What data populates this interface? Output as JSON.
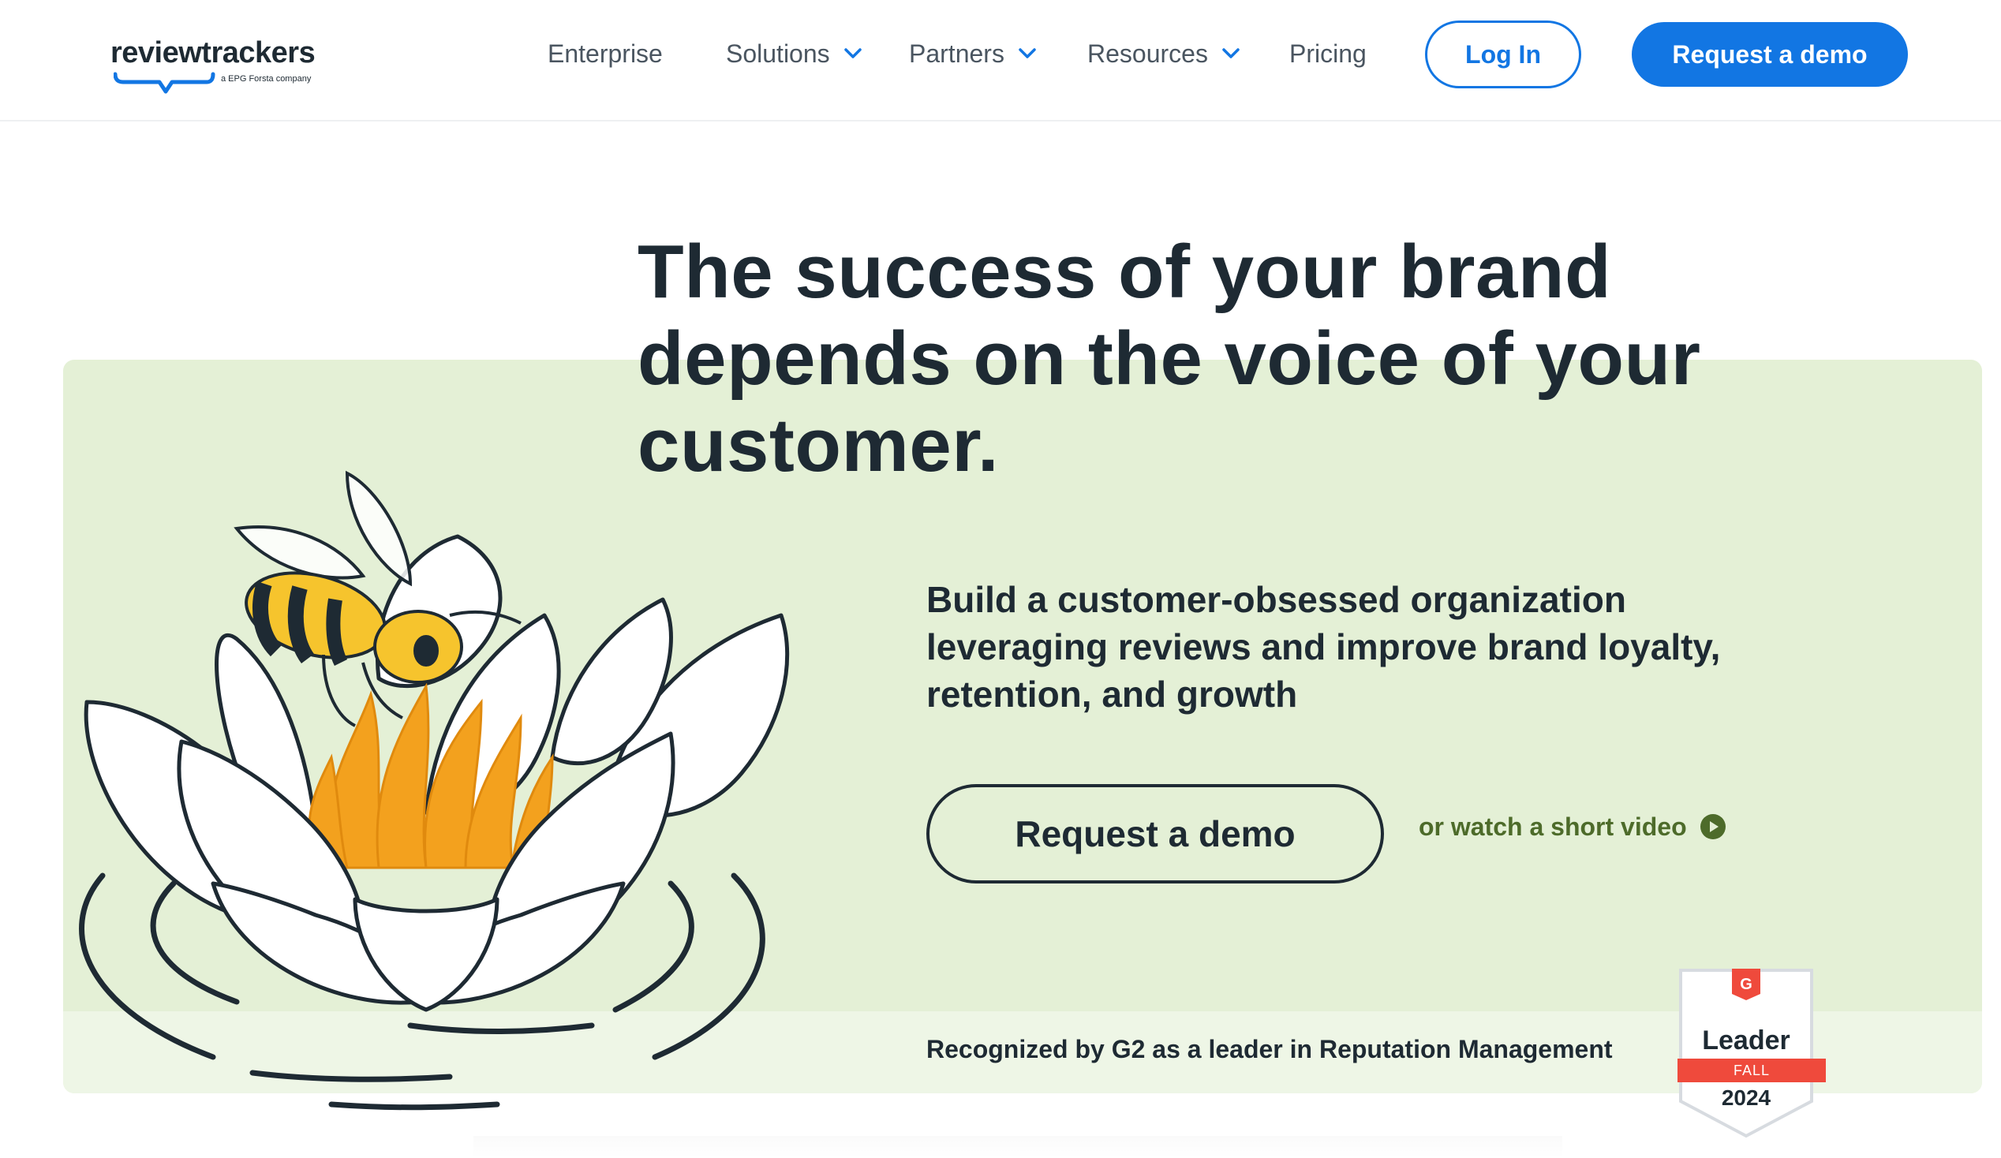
{
  "nav": {
    "logo_text": "reviewtrackers",
    "logo_sub": "a EPG Forsta company",
    "items": [
      {
        "label": "Enterprise",
        "dropdown": false
      },
      {
        "label": "Solutions",
        "dropdown": true
      },
      {
        "label": "Partners",
        "dropdown": true
      },
      {
        "label": "Resources",
        "dropdown": true
      },
      {
        "label": "Pricing",
        "dropdown": false
      }
    ],
    "login_label": "Log In",
    "demo_label": "Request a demo"
  },
  "hero": {
    "headline_lines": [
      "The success of your brand",
      "depends on the voice of your",
      "customer."
    ],
    "sub_lines": [
      "Build a customer-obsessed organization",
      "leveraging reviews and improve brand loyalty,",
      "retention, and growth"
    ],
    "cta_label": "Request a demo",
    "video_link": "or watch a short video",
    "recognized": "Recognized by G2 as a leader in Reputation Management"
  },
  "badge": {
    "title": "Leader",
    "season": "FALL",
    "year": "2024"
  },
  "colors": {
    "primary": "#1276e3",
    "hero_bg": "#e4f0d6",
    "text": "#1e2a33",
    "link_green": "#4d6b2a",
    "badge_red": "#ef4a3c",
    "bee_yellow": "#f6c42d",
    "flower_orange": "#f3a11e"
  },
  "icons": {
    "chevron": "chevron-down-icon",
    "play": "play-circle-icon",
    "logo": "speech-bubble-icon"
  }
}
